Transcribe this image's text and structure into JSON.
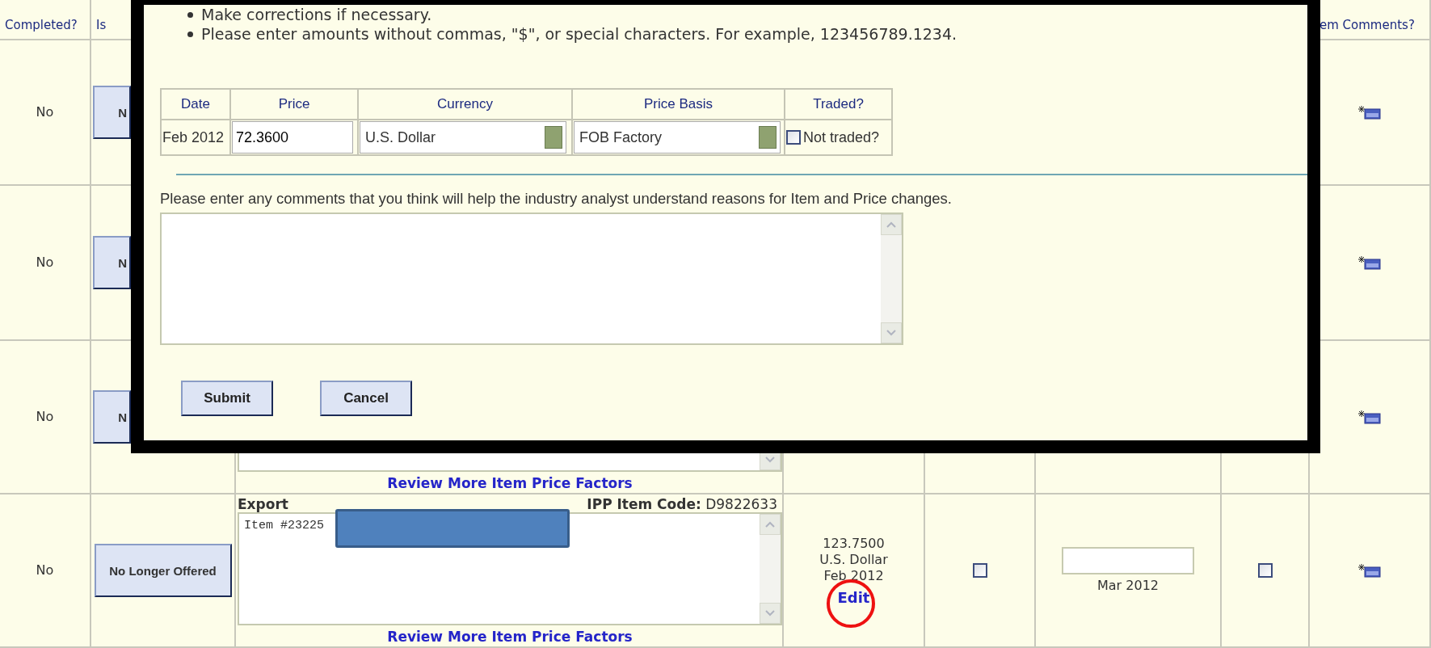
{
  "table": {
    "columns": [
      "Completed?",
      "Is",
      "em Comments?"
    ],
    "rows": [
      {
        "kind": "covered",
        "completed": "No",
        "status_button": "N"
      },
      {
        "kind": "covered",
        "completed": "No",
        "status_button": "N"
      },
      {
        "kind": "covered",
        "completed": "No",
        "status_button": "N",
        "review_link": "Review More Item Price Factors"
      },
      {
        "kind": "full",
        "completed": "No",
        "status_button": "No Longer Offered",
        "type": "Export",
        "ipp_code": "**IPP Item Code:** D9822633",
        "description": "Item #23225",
        "review_link": "Review More Item Price Factors",
        "price": "123.7500",
        "currency": "U.S. Dollar",
        "date": "Feb 2012",
        "edit_link": "Edit",
        "edit_circled": true,
        "checkbox_1": false,
        "next_date_value": "",
        "next_date": "Mar 2012",
        "checkbox_2": false
      }
    ]
  },
  "dialog": {
    "instructions": [
      "Make corrections if necessary.",
      "Please enter amounts without commas, \"$\", or special characters. For example, 123456789.1234."
    ],
    "price_table": {
      "columns": [
        "Date",
        "Price",
        "Currency",
        "Price Basis",
        "Traded?"
      ],
      "row": {
        "date": "Feb 2012",
        "price": "72.3600",
        "currency": "U.S. Dollar",
        "price_basis": "FOB Factory",
        "not_traded_label": "Not traded?",
        "not_traded": false
      }
    },
    "comments_label": "Please enter any comments that you think will help the industry analyst understand reasons for Item and Price changes.",
    "buttons": [
      "Submit",
      "Cancel"
    ]
  }
}
